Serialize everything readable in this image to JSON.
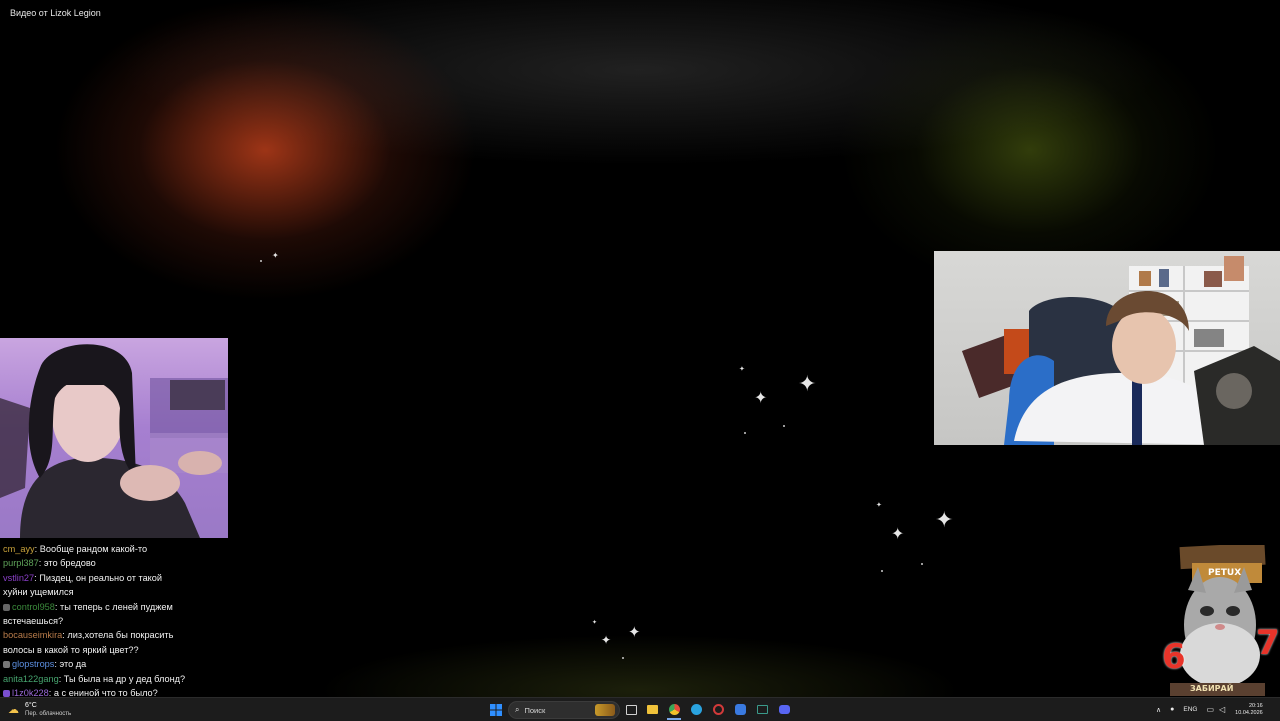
{
  "window": {
    "title": "Видео от Lizok Legion"
  },
  "chat": {
    "messages": [
      {
        "user": "cm_ayy",
        "text": ": Вообще рандом какой-то",
        "color": "#c7a13a",
        "badge": ""
      },
      {
        "user": "purpl387",
        "text": ": это бредово",
        "color": "#5fa35a",
        "badge": ""
      },
      {
        "user": "vstlin27",
        "text": ": Пиздец, он реально от такой",
        "color": "#8b3fc9",
        "badge": ""
      },
      {
        "user": "",
        "text": "хуйни ущемился",
        "color": "#8b3fc9",
        "badge": ""
      },
      {
        "user": "control958",
        "text": ": ты теперь с леней пуджем",
        "color": "#3b8a3b",
        "badge": "#666666"
      },
      {
        "user": "",
        "text": "встечаешься?",
        "color": "#3b8a3b",
        "badge": ""
      },
      {
        "user": "bocauseimkira",
        "text": ": лиз,хотела бы покрасить",
        "color": "#b87b4a",
        "badge": ""
      },
      {
        "user": "",
        "text": "волосы в какой то яркий цвет?? ",
        "color": "#b87b4a",
        "badge": ""
      },
      {
        "user": "glopstrops",
        "text": ": это да",
        "color": "#5c8fe0",
        "badge": "#777777"
      },
      {
        "user": "anita122gang",
        "text": ": Ты была на др у дед блонд?",
        "color": "#46a46e",
        "badge": ""
      },
      {
        "user": "l1z0k228",
        "text": ": а с ениной что то было?",
        "color": "#9b6ad8",
        "badge": "#7a4fd0"
      }
    ]
  },
  "sticker": {
    "label": "PETUX",
    "left_number": "6",
    "right_number": "7",
    "bottom_text": "ЗАБИРАЙ"
  },
  "taskbar": {
    "weather_temp": "6°C",
    "weather_desc": "Пер. облачность",
    "search_placeholder": "Поиск",
    "language": "ENG",
    "time": "20:16",
    "date": "10.04.2026"
  },
  "colors": {
    "accent_windows": "#2f8fff",
    "background": "#000000"
  }
}
